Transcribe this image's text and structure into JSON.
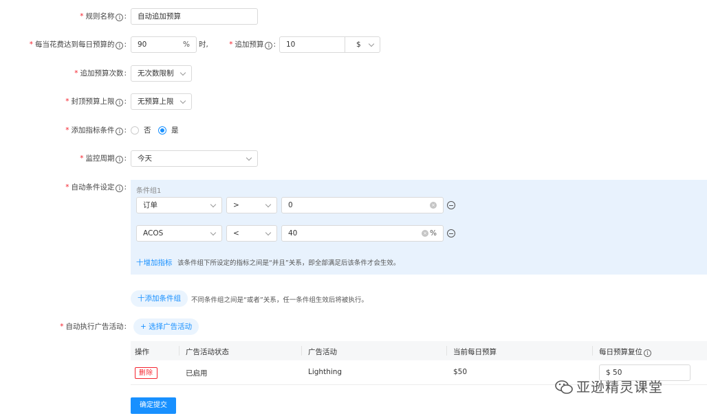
{
  "form": {
    "rule_name": {
      "label": "规则名称",
      "value": "自动追加预算"
    },
    "spend_threshold": {
      "label": "每当花费达到每日预算的",
      "value": "90",
      "suffix": "%",
      "after": "时,"
    },
    "add_budget": {
      "label": "追加预算",
      "value": "10",
      "unit": "$"
    },
    "add_count": {
      "label": "追加预算次数",
      "value": "无次数限制"
    },
    "budget_cap": {
      "label": "封顶预算上限",
      "value": "无预算上限"
    },
    "metric_condition": {
      "label": "添加指标条件",
      "options": [
        "否",
        "是"
      ],
      "selected": "是"
    },
    "monitor_period": {
      "label": "监控周期",
      "value": "今天"
    },
    "auto_condition": {
      "label": "自动条件设定",
      "group_title": "条件组1",
      "rows": [
        {
          "metric": "订单",
          "op": ">",
          "value": "0",
          "suffix": ""
        },
        {
          "metric": "ACOS",
          "op": "<",
          "value": "40",
          "suffix": "%"
        }
      ],
      "add_metric_label": "十增加指标",
      "add_metric_hint": "该条件组下所设定的指标之间是“并且”关系，即全部满足后该条件才会生效。",
      "add_group_label": "十添加条件组",
      "add_group_hint": "不同条件组之间是“或者”关系，任一条件组生效后将被执行。"
    },
    "auto_campaign": {
      "label": "自动执行广告活动",
      "select_label": "+ 选择广告活动"
    }
  },
  "table": {
    "headers": [
      "操作",
      "广告活动状态",
      "广告活动",
      "当前每日预算",
      "每日预算复位"
    ],
    "rows": [
      {
        "action": "删除",
        "status": "已启用",
        "campaign": "Lighthing",
        "budget": "$50",
        "reset": "$ 50"
      }
    ]
  },
  "submit_label": "确定提交",
  "watermark": "亚逊精灵课堂",
  "colors": {
    "primary": "#1890ff",
    "required": "#f5222d",
    "panel_bg": "#e8f2fd"
  }
}
